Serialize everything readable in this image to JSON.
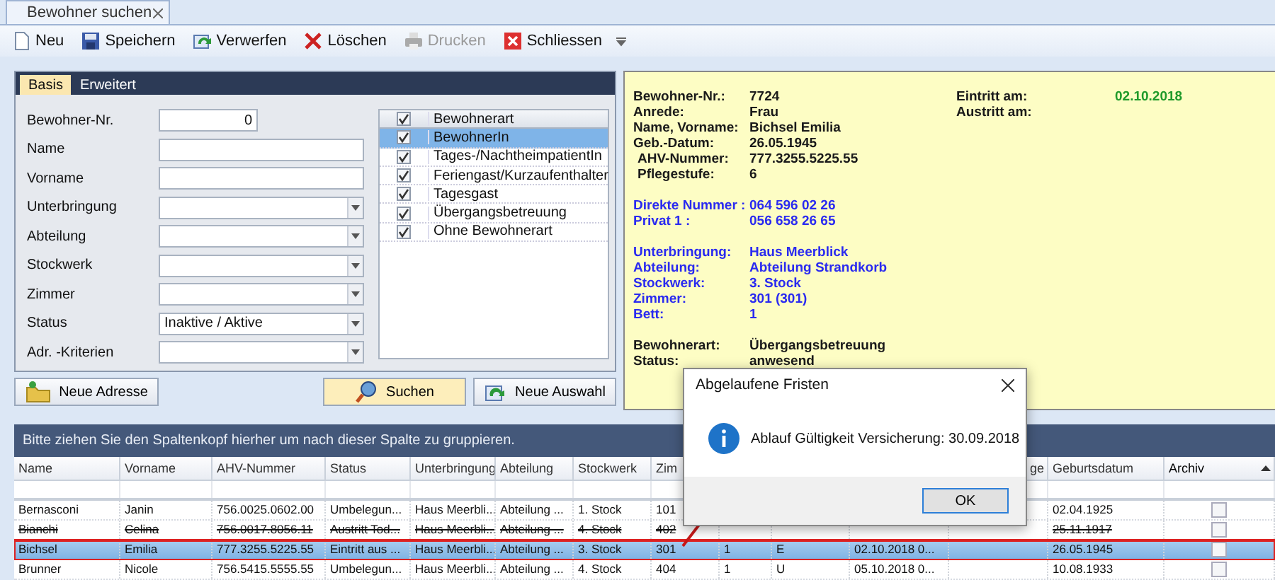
{
  "document_tab": {
    "title": "Bewohner suchen"
  },
  "toolbar": [
    {
      "label": "Neu",
      "kind": "new",
      "disabled": false
    },
    {
      "label": "Speichern",
      "kind": "save",
      "disabled": false
    },
    {
      "label": "Verwerfen",
      "kind": "discard",
      "disabled": false
    },
    {
      "label": "Löschen",
      "kind": "delete",
      "disabled": false
    },
    {
      "label": "Drucken",
      "kind": "print",
      "disabled": true
    },
    {
      "label": "Schliessen",
      "kind": "close",
      "disabled": false
    }
  ],
  "form_tabs": [
    {
      "label": "Basis",
      "selected": true
    },
    {
      "label": "Erweitert",
      "selected": false
    }
  ],
  "fields": [
    {
      "label": "Bewohner-Nr.",
      "kind": "number",
      "value": "0"
    },
    {
      "label": "Name",
      "kind": "text"
    },
    {
      "label": "Vorname",
      "kind": "text"
    },
    {
      "label": "Unterbringung",
      "kind": "dropdown"
    },
    {
      "label": "Abteilung",
      "kind": "dropdown"
    },
    {
      "label": "Stockwerk",
      "kind": "dropdown"
    },
    {
      "label": "Zimmer",
      "kind": "dropdown"
    },
    {
      "label": "Status",
      "kind": "dropdown",
      "value": "Inaktive / Aktive"
    },
    {
      "label": "Adr. -Kriterien",
      "kind": "dropdown"
    }
  ],
  "type_list": {
    "header": "Bewohnerart",
    "header_checked": true,
    "items": [
      {
        "label": "BewohnerIn",
        "checked": true,
        "selected": true
      },
      {
        "label": "Tages-/NachtheimpatientIn",
        "checked": true,
        "selected": false
      },
      {
        "label": "Feriengast/Kurzaufenthalter",
        "checked": true,
        "selected": false
      },
      {
        "label": "Tagesgast",
        "checked": true,
        "selected": false
      },
      {
        "label": "Übergangsbetreuung",
        "checked": true,
        "selected": false
      },
      {
        "label": "Ohne Bewohnerart",
        "checked": true,
        "selected": false
      }
    ]
  },
  "buttons": [
    {
      "label": "Neue Adresse",
      "kind": "folder",
      "highlighted": false
    },
    {
      "label": "Suchen",
      "kind": "search",
      "highlighted": true
    },
    {
      "label": "Neue Auswahl",
      "kind": "refresh",
      "highlighted": false
    }
  ],
  "details": {
    "groups": [
      {
        "color": "#1a1a1a",
        "rows": [
          {
            "label": "Bewohner-Nr.:",
            "value": "7724",
            "indented": false
          },
          {
            "label": "Anrede:",
            "value": "Frau",
            "indented": false
          },
          {
            "label": "Name, Vorname:",
            "value": "Bichsel Emilia",
            "indented": false
          },
          {
            "label": "Geb.-Datum:",
            "value": "26.05.1945",
            "indented": false
          },
          {
            "label": "AHV-Nummer:",
            "value": "777.3255.5225.55",
            "indented": true
          },
          {
            "label": "Pflegestufe:",
            "value": "6",
            "indented": true
          }
        ]
      },
      {
        "color": "#2a2af0",
        "rows": [
          {
            "label": "Direkte Nummer :",
            "value": "064 596 02 26",
            "indented": false
          },
          {
            "label": "Privat 1 :",
            "value": "056 658 26 65",
            "indented": false
          }
        ]
      },
      {
        "color": "#2a2af0",
        "rows": [
          {
            "label": "Unterbringung:",
            "value": "Haus Meerblick",
            "indented": false
          },
          {
            "label": "Abteilung:",
            "value": "Abteilung Strandkorb",
            "indented": false
          },
          {
            "label": "Stockwerk:",
            "value": "3. Stock",
            "indented": false
          },
          {
            "label": "Zimmer:",
            "value": "301 (301)",
            "indented": false
          },
          {
            "label": "Bett:",
            "value": "1",
            "indented": false
          }
        ]
      },
      {
        "color": "#1a1a1a",
        "rows": [
          {
            "label": "Bewohnerart:",
            "value": "Übergangsbetreuung",
            "indented": false
          },
          {
            "label": "Status:",
            "value": "anwesend",
            "indented": false
          }
        ]
      }
    ],
    "side": [
      {
        "label": "Eintritt am:",
        "value": "02.10.2018",
        "color": "#1f9a2a"
      },
      {
        "label": "Austritt am:"
      }
    ]
  },
  "grid": {
    "group_hint": "Bitte ziehen Sie den Spaltenkopf hierher um nach dieser Spalte zu gruppieren.",
    "columns": [
      {
        "label": "Name",
        "sorted": false
      },
      {
        "label": "Vorname",
        "sorted": false
      },
      {
        "label": "AHV-Nummer",
        "sorted": false
      },
      {
        "label": "Status",
        "sorted": false
      },
      {
        "label": "Unterbringung",
        "sorted": false
      },
      {
        "label": "Abteilung",
        "sorted": false
      },
      {
        "label": "Stockwerk",
        "sorted": false
      },
      {
        "label": "Zim",
        "sorted": false
      },
      {},
      {},
      {},
      {
        "label": "ge",
        "sorted": false
      },
      {
        "label": "Geburtsdatum",
        "sorted": false
      },
      {
        "label": "Archiv",
        "sorted": true
      }
    ],
    "rows": [
      {
        "cells": [
          "Bernasconi",
          "Janin",
          "756.0025.0602.00",
          "Umbelegun...",
          "Haus Meerbli...",
          "Abteilung ...",
          "1. Stock",
          "101",
          null,
          null,
          null,
          null,
          "02.04.1925"
        ],
        "struck": false,
        "selected": false,
        "highlighted": false,
        "archived": false
      },
      {
        "cells": [
          "Bianchi",
          "Celina",
          "756.0017.8056.11",
          "Austritt Tod...",
          "Haus Meerbli...",
          "Abteilung ...",
          "4. Stock",
          "402",
          null,
          null,
          null,
          null,
          "25.11.1917"
        ],
        "struck": true,
        "selected": false,
        "highlighted": false,
        "archived": false
      },
      {
        "cells": [
          "Bichsel",
          "Emilia",
          "777.3255.5225.55",
          "Eintritt aus ...",
          "Haus Meerbli...",
          "Abteilung ...",
          "3. Stock",
          "301",
          "1",
          "E",
          "02.10.2018 0...",
          null,
          "26.05.1945"
        ],
        "struck": false,
        "selected": true,
        "highlighted": true,
        "archived": false
      },
      {
        "cells": [
          "Brunner",
          "Nicole",
          "756.5415.5555.55",
          "Umbelegun...",
          "Haus Meerbli...",
          "Abteilung ...",
          "4. Stock",
          "404",
          "1",
          "U",
          "05.10.2018 0...",
          null,
          "10.08.1933"
        ],
        "struck": false,
        "selected": false,
        "highlighted": false,
        "archived": false
      }
    ]
  },
  "dialog": {
    "title": "Abgelaufene Fristen",
    "message": "Ablauf Gültigkeit Versicherung: 30.09.2018",
    "button": "OK"
  }
}
